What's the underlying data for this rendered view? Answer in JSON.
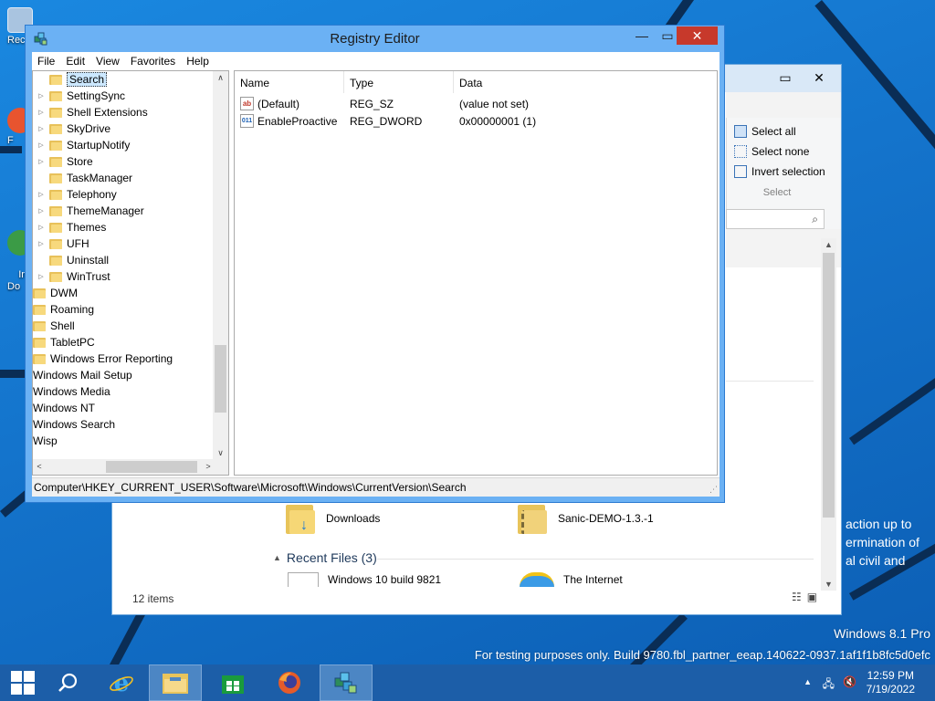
{
  "desktop": {
    "icons": [
      {
        "label": "Rec",
        "color": "#9bb8d6"
      },
      {
        "label": "F",
        "color": "#e8542f"
      },
      {
        "label": "In\nDo",
        "color": "#3b9b46"
      }
    ],
    "watermark_line1": "Windows 8.1 Pro",
    "watermark_line2": "For testing purposes only. Build 9780.fbl_partner_eeap.140622-0937.1af1f1b8fc5d0efc",
    "bg_text": [
      "action up to",
      "ermination of",
      "al civil and"
    ]
  },
  "explorer": {
    "ribbon": {
      "select_all": "Select all",
      "select_none": "Select none",
      "invert_selection": "Invert selection",
      "group_label": "Select"
    },
    "files": [
      {
        "name": "Downloads",
        "icon": "downloads-folder-icon"
      },
      {
        "name": "Sanic-DEMO-1.3.-1",
        "icon": "zip-folder-icon"
      }
    ],
    "recent_header": "Recent Files (3)",
    "recent": [
      {
        "name": "Windows 10 build 9821",
        "icon": "document-icon"
      },
      {
        "name": "The Internet",
        "icon": "internet-icon"
      }
    ],
    "status": "12 items"
  },
  "regedit": {
    "title": "Registry Editor",
    "menu": [
      "File",
      "Edit",
      "View",
      "Favorites",
      "Help"
    ],
    "tree": [
      {
        "label": "Search",
        "indent": 2,
        "expander": false,
        "selected": true,
        "folder": true
      },
      {
        "label": "SettingSync",
        "indent": 2,
        "expander": true,
        "folder": true
      },
      {
        "label": "Shell Extensions",
        "indent": 2,
        "expander": true,
        "folder": true
      },
      {
        "label": "SkyDrive",
        "indent": 2,
        "expander": true,
        "folder": true
      },
      {
        "label": "StartupNotify",
        "indent": 2,
        "expander": true,
        "folder": true
      },
      {
        "label": "Store",
        "indent": 2,
        "expander": true,
        "folder": true
      },
      {
        "label": "TaskManager",
        "indent": 2,
        "expander": false,
        "folder": true
      },
      {
        "label": "Telephony",
        "indent": 2,
        "expander": true,
        "folder": true
      },
      {
        "label": "ThemeManager",
        "indent": 2,
        "expander": true,
        "folder": true
      },
      {
        "label": "Themes",
        "indent": 2,
        "expander": true,
        "folder": true
      },
      {
        "label": "UFH",
        "indent": 2,
        "expander": true,
        "folder": true
      },
      {
        "label": "Uninstall",
        "indent": 2,
        "expander": false,
        "folder": true
      },
      {
        "label": "WinTrust",
        "indent": 2,
        "expander": true,
        "folder": true
      },
      {
        "label": "DWM",
        "indent": 1,
        "expander": false,
        "folder": true
      },
      {
        "label": "Roaming",
        "indent": 1,
        "expander": false,
        "folder": true
      },
      {
        "label": "Shell",
        "indent": 1,
        "expander": false,
        "folder": true
      },
      {
        "label": "TabletPC",
        "indent": 1,
        "expander": false,
        "folder": true
      },
      {
        "label": "Windows Error Reporting",
        "indent": 1,
        "expander": false,
        "folder": true
      },
      {
        "label": "Windows Mail Setup",
        "indent": 0,
        "expander": false,
        "folder": false
      },
      {
        "label": "Windows Media",
        "indent": 0,
        "expander": false,
        "folder": false
      },
      {
        "label": "Windows NT",
        "indent": 0,
        "expander": false,
        "folder": false
      },
      {
        "label": "Windows Search",
        "indent": 0,
        "expander": false,
        "folder": false
      },
      {
        "label": "Wisp",
        "indent": 0,
        "expander": false,
        "folder": false
      }
    ],
    "columns": {
      "name": "Name",
      "type": "Type",
      "data": "Data"
    },
    "values": [
      {
        "name": "(Default)",
        "type": "REG_SZ",
        "data": "(value not set)",
        "icon": "string-value-icon"
      },
      {
        "name": "EnableProactive",
        "type": "REG_DWORD",
        "data": "0x00000001 (1)",
        "icon": "binary-value-icon"
      }
    ],
    "status_path": "Computer\\HKEY_CURRENT_USER\\Software\\Microsoft\\Windows\\CurrentVersion\\Search"
  },
  "taskbar": {
    "items": [
      {
        "name": "start-button",
        "icon": "windows-logo-icon"
      },
      {
        "name": "search",
        "icon": "search-icon"
      },
      {
        "name": "internet-explorer",
        "icon": "ie-icon"
      },
      {
        "name": "file-explorer",
        "icon": "folder-icon"
      },
      {
        "name": "store",
        "icon": "store-icon"
      },
      {
        "name": "firefox",
        "icon": "firefox-icon"
      },
      {
        "name": "registry-editor",
        "icon": "regedit-icon"
      }
    ],
    "time": "12:59 PM",
    "date": "7/19/2022"
  }
}
